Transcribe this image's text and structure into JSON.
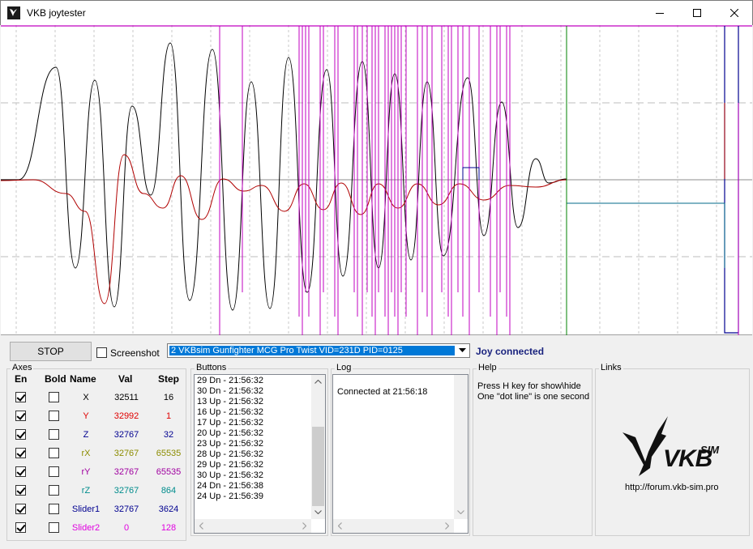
{
  "window": {
    "title": "VKB joytester"
  },
  "controls": {
    "stop_label": "STOP",
    "screenshot_label": "Screenshot",
    "screenshot_checked": false,
    "device_selected": "2  VKBsim Gunfighter MCG Pro Twist  VID=231D PID=0125",
    "status": "Joy connected"
  },
  "axes": {
    "title": "Axes",
    "headers": {
      "en": "En",
      "bold": "Bold",
      "name": "Name",
      "val": "Val",
      "step": "Step"
    },
    "rows": [
      {
        "name": "X",
        "val": "32511",
        "step": "16",
        "color": "#000000",
        "en": true,
        "bold": false
      },
      {
        "name": "Y",
        "val": "32992",
        "step": "1",
        "color": "#e00000",
        "en": true,
        "bold": false
      },
      {
        "name": "Z",
        "val": "32767",
        "step": "32",
        "color": "#000090",
        "en": true,
        "bold": false
      },
      {
        "name": "rX",
        "val": "32767",
        "step": "65535",
        "color": "#8c8c00",
        "en": true,
        "bold": false
      },
      {
        "name": "rY",
        "val": "32767",
        "step": "65535",
        "color": "#a000a0",
        "en": true,
        "bold": false
      },
      {
        "name": "rZ",
        "val": "32767",
        "step": "864",
        "color": "#008c8c",
        "en": true,
        "bold": false
      },
      {
        "name": "Slider1",
        "val": "32767",
        "step": "3624",
        "color": "#000090",
        "en": true,
        "bold": false
      },
      {
        "name": "Slider2",
        "val": "0",
        "step": "128",
        "color": "#e000e0",
        "en": true,
        "bold": false
      }
    ]
  },
  "buttons": {
    "title": "Buttons",
    "lines": [
      "29 Dn - 21:56:32",
      "30 Dn - 21:56:32",
      "13 Up - 21:56:32",
      "16 Up - 21:56:32",
      "17 Up - 21:56:32",
      "20 Up - 21:56:32",
      "23 Up - 21:56:32",
      "28 Up - 21:56:32",
      "29 Up - 21:56:32",
      "30 Up - 21:56:32",
      "24 Dn - 21:56:38",
      "24 Up - 21:56:39"
    ]
  },
  "log": {
    "title": "Log",
    "lines": [
      "Connected at 21:56:18"
    ]
  },
  "help": {
    "title": "Help",
    "lines": [
      "Press H key for show\\hide",
      "One \"dot line\" is one second"
    ]
  },
  "links": {
    "title": "Links",
    "url": "http://forum.vkb-sim.pro",
    "logo_main": "VKB",
    "logo_sub": "SIM"
  },
  "plot": {
    "colors": {
      "x": "#000000",
      "y": "#b00000",
      "button": "#c000c0",
      "navy": "#000090",
      "teal": "#006a8a",
      "green": "#008000"
    }
  }
}
